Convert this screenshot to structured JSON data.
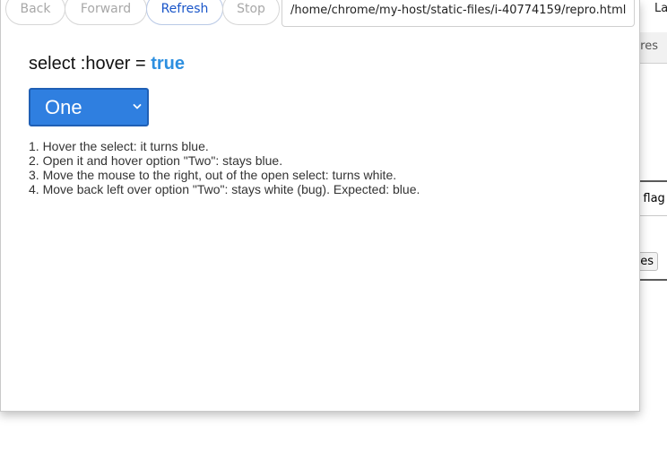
{
  "toolbar": {
    "back": "Back",
    "forward": "Forward",
    "refresh": "Refresh",
    "stop": "Stop",
    "url": "/home/chrome/my-host/static-files/i-40774159/repro.html"
  },
  "page": {
    "heading_prefix": "select :hover = ",
    "heading_value": "true",
    "select_value": "One",
    "steps": [
      "1. Hover the select: it turns blue.",
      "2. Open it and hover option \"Two\": stays blue.",
      "3. Move the mouse to the right, out of the open select: turns white.",
      "4. Move back left over option \"Two\": stays white (bug). Expected: blue."
    ]
  },
  "background": {
    "tab_fragment": "La",
    "strip_fragment": "s/res",
    "button1_fragment": "d flag",
    "button2_fragment": "hes"
  },
  "colors": {
    "accent": "#2d8fe0",
    "select_bg": "#2f7fe0",
    "nav_active": "#1a56c9"
  }
}
